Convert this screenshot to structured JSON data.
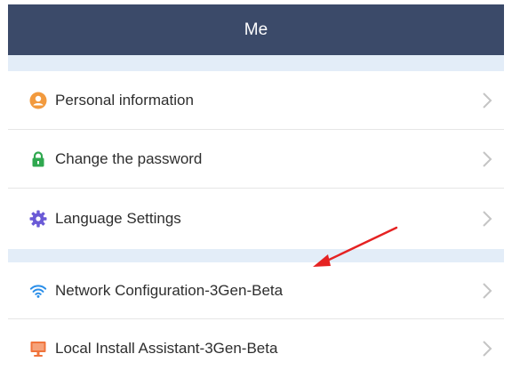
{
  "header": {
    "title": "Me"
  },
  "menu": {
    "group1": [
      {
        "label": "Personal information",
        "icon": "person-icon",
        "icon_color": "#f29a3e"
      },
      {
        "label": "Change the password",
        "icon": "lock-icon",
        "icon_color": "#2fa84f"
      },
      {
        "label": "Language Settings",
        "icon": "gear-icon",
        "icon_color": "#6a5ad6"
      }
    ],
    "group2": [
      {
        "label": "Network Configuration-3Gen-Beta",
        "icon": "wifi-icon",
        "icon_color": "#2a8ee8"
      },
      {
        "label": "Local Install Assistant-3Gen-Beta",
        "icon": "monitor-icon",
        "icon_color": "#f0743c"
      }
    ]
  },
  "colors": {
    "nav_background": "#3b4a69",
    "section_band": "#e3edf8",
    "annotation_arrow": "#e52222"
  }
}
